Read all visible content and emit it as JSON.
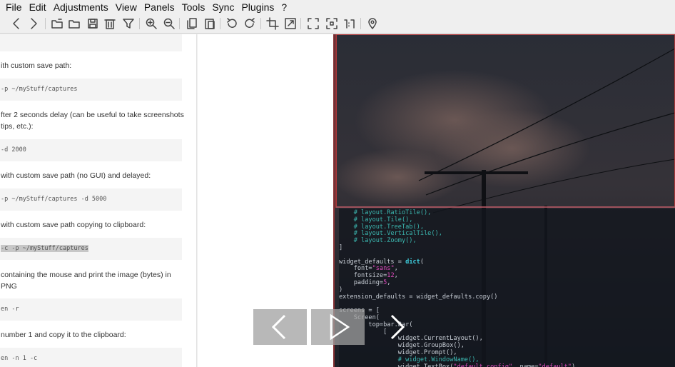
{
  "menu": {
    "items": [
      "File",
      "Edit",
      "Adjustments",
      "View",
      "Panels",
      "Tools",
      "Sync",
      "Plugins",
      "?"
    ]
  },
  "toolbar": {
    "buttons": [
      "back-icon",
      "forward-icon",
      "new-folder-icon",
      "open-folder-icon",
      "save-icon",
      "delete-icon",
      "filter-icon",
      "zoom-in-icon",
      "zoom-out-icon",
      "copy-icon",
      "paste-icon",
      "rotate-left-icon",
      "rotate-right-icon",
      "crop-icon",
      "resize-icon",
      "fullscreen-icon",
      "fit-icon",
      "actual-size-icon",
      "location-icon"
    ]
  },
  "doc": {
    "code1": "",
    "text1": "ith custom save path:",
    "code2": "-p ~/myStuff/captures",
    "text2a": "fter 2 seconds delay (can be useful to take screenshots",
    "text2b": "tips, etc.):",
    "code3": "-d 2000",
    "text3": "with custom save path (no GUI) and delayed:",
    "code4": " -p ~/myStuff/captures -d 5000",
    "text4": "with custom save path copying to clipboard:",
    "code5_highlight": "-c -p ~/myStuff/captures",
    "text5a": "containing the mouse and print the image (bytes) in PNG",
    "code6": "en -r",
    "text6": "number 1 and copy it to the clipboard:",
    "code7": "en -n 1 -c"
  },
  "code_overlay": {
    "lines": [
      {
        "segments": [
          {
            "c": "c-comment",
            "t": "    # layout.RatioTile(),"
          }
        ]
      },
      {
        "segments": [
          {
            "c": "c-comment",
            "t": "    # layout.Tile(),"
          }
        ]
      },
      {
        "segments": [
          {
            "c": "c-comment",
            "t": "    # layout.TreeTab(),"
          }
        ]
      },
      {
        "segments": [
          {
            "c": "c-comment",
            "t": "    # layout.VerticalTile(),"
          }
        ]
      },
      {
        "segments": [
          {
            "c": "c-comment",
            "t": "    # layout.Zoomy(),"
          }
        ]
      },
      {
        "segments": [
          {
            "c": "c-plain",
            "t": "]"
          }
        ]
      },
      {
        "segments": [
          {
            "c": "c-plain",
            "t": ""
          }
        ]
      },
      {
        "segments": [
          {
            "c": "c-plain",
            "t": "widget_defaults = "
          },
          {
            "c": "c-kw",
            "t": "dict"
          },
          {
            "c": "c-plain",
            "t": "("
          }
        ]
      },
      {
        "segments": [
          {
            "c": "c-plain",
            "t": "    font="
          },
          {
            "c": "c-str",
            "t": "\"sans\""
          },
          {
            "c": "c-plain",
            "t": ","
          }
        ]
      },
      {
        "segments": [
          {
            "c": "c-plain",
            "t": "    fontsize="
          },
          {
            "c": "c-num",
            "t": "12"
          },
          {
            "c": "c-plain",
            "t": ","
          }
        ]
      },
      {
        "segments": [
          {
            "c": "c-plain",
            "t": "    padding="
          },
          {
            "c": "c-num",
            "t": "5"
          },
          {
            "c": "c-plain",
            "t": ","
          }
        ]
      },
      {
        "segments": [
          {
            "c": "c-plain",
            "t": ")"
          }
        ]
      },
      {
        "segments": [
          {
            "c": "c-plain",
            "t": "extension_defaults = widget_defaults.copy()"
          }
        ]
      },
      {
        "segments": [
          {
            "c": "c-plain",
            "t": ""
          }
        ]
      },
      {
        "segments": [
          {
            "c": "c-plain",
            "t": "screens = ["
          }
        ]
      },
      {
        "segments": [
          {
            "c": "c-plain",
            "t": "    Screen("
          }
        ]
      },
      {
        "segments": [
          {
            "c": "c-plain",
            "t": "        top=bar.Bar("
          }
        ]
      },
      {
        "segments": [
          {
            "c": "c-plain",
            "t": "            ["
          }
        ]
      },
      {
        "segments": [
          {
            "c": "c-plain",
            "t": "                widget.CurrentLayout(),"
          }
        ]
      },
      {
        "segments": [
          {
            "c": "c-plain",
            "t": "                widget.GroupBox(),"
          }
        ]
      },
      {
        "segments": [
          {
            "c": "c-plain",
            "t": "                widget.Prompt(),"
          }
        ]
      },
      {
        "segments": [
          {
            "c": "c-comment",
            "t": "                # widget.WindowName(),"
          }
        ]
      },
      {
        "segments": [
          {
            "c": "c-plain",
            "t": "                widget.TextBox("
          },
          {
            "c": "c-str",
            "t": "\"default config\""
          },
          {
            "c": "c-plain",
            "t": ", name="
          },
          {
            "c": "c-str",
            "t": "\"default\""
          },
          {
            "c": "c-plain",
            "t": "),"
          }
        ]
      }
    ]
  },
  "overlay_nav": {
    "prev_icon": "chevron-left-icon",
    "play_icon": "play-icon",
    "next_icon": "chevron-right-icon"
  },
  "colors": {
    "accent_red": "#d63a3a",
    "image_bg": "#1b1d22"
  }
}
